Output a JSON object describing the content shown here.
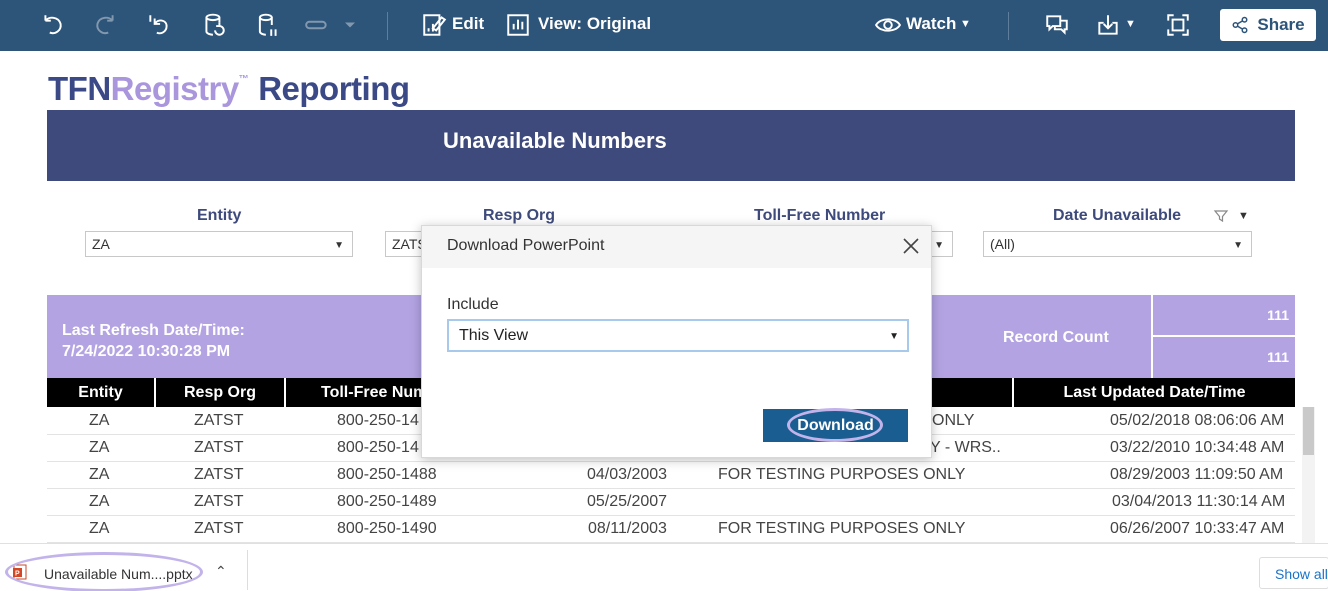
{
  "toolbar": {
    "edit_label": "Edit",
    "view_label": "View: Original",
    "watch_label": "Watch",
    "share_label": "Share"
  },
  "logo": {
    "part1": "TFN",
    "part2": "Registry",
    "tm": "™",
    "part3": "Reporting"
  },
  "banner": {
    "title": "Unavailable Numbers"
  },
  "filters": [
    {
      "label": "Entity",
      "value": "ZA"
    },
    {
      "label": "Resp Org",
      "value": "ZATS"
    },
    {
      "label": "Toll-Free Number",
      "value": ""
    },
    {
      "label": "Date Unavailable",
      "value": "(All)"
    }
  ],
  "summary": {
    "refresh_line1": "Last Refresh Date/Time:",
    "refresh_line2": "7/24/2022 10:30:28 PM",
    "record_count_label": "Record Count",
    "record_count_1": "111",
    "record_count_2": "111"
  },
  "table": {
    "columns": [
      "Entity",
      "Resp Org",
      "Toll-Free Num",
      "Last Updated Date/Time"
    ],
    "rows": [
      {
        "entity": "ZA",
        "resp_org": "ZATST",
        "number": "800-250-14",
        "date": "",
        "reason": "ONLY",
        "updated": "05/02/2018 08:06:06 AM"
      },
      {
        "entity": "ZA",
        "resp_org": "ZATST",
        "number": "800-250-14",
        "date": "",
        "reason": "Y  - WRS..",
        "updated": "03/22/2010 10:34:48 AM"
      },
      {
        "entity": "ZA",
        "resp_org": "ZATST",
        "number": "800-250-1488",
        "date": "04/03/2003",
        "reason": "FOR TESTING PURPOSES ONLY",
        "updated": "08/29/2003 11:09:50 AM"
      },
      {
        "entity": "ZA",
        "resp_org": "ZATST",
        "number": "800-250-1489",
        "date": "05/25/2007",
        "reason": "",
        "updated": "03/04/2013 11:30:14 AM"
      },
      {
        "entity": "ZA",
        "resp_org": "ZATST",
        "number": "800-250-1490",
        "date": "08/11/2003",
        "reason": "FOR TESTING PURPOSES ONLY",
        "updated": "06/26/2007 10:33:47 AM"
      }
    ]
  },
  "modal": {
    "title": "Download PowerPoint",
    "include_label": "Include",
    "include_value": "This View",
    "download_label": "Download"
  },
  "download_bar": {
    "file_name": "Unavailable Num....pptx",
    "show_all": "Show all"
  },
  "colors": {
    "toolbar": "#2d5479",
    "banner": "#3e4a7b",
    "lavender": "#b3a3e2",
    "primary_button": "#1a5e91"
  },
  "icons": [
    "undo-icon",
    "redo-icon",
    "revert-icon",
    "refresh-data-icon",
    "pause-updates-icon",
    "toggle-icon",
    "edit-icon",
    "view-icon",
    "watch-icon",
    "comments-icon",
    "download-icon",
    "fullscreen-icon",
    "share-icon",
    "close-icon",
    "filter-icon",
    "powerpoint-file-icon"
  ]
}
